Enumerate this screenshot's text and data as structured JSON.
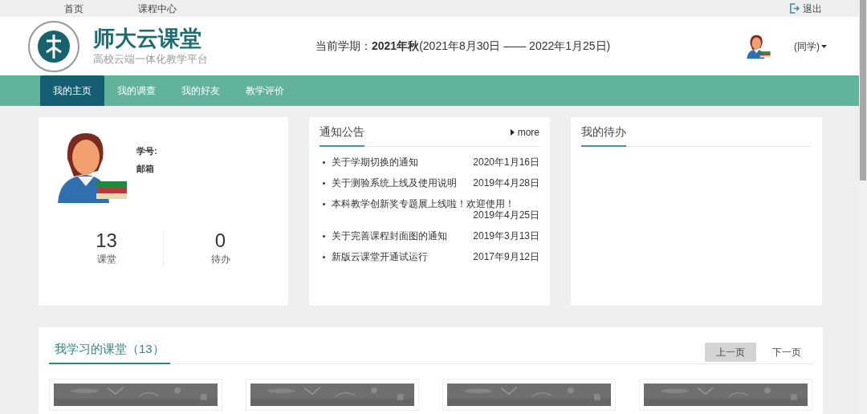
{
  "top_bar": {
    "links": [
      "首页",
      "课程中心"
    ],
    "logout": "退出"
  },
  "header": {
    "site_title": "师大云课堂",
    "site_subtitle": "高校云端一体化教学平台",
    "term_label": "当前学期：",
    "term_name": "2021年秋",
    "term_range": "(2021年8月30日 —— 2022年1月25日)",
    "user_menu": "(同学)"
  },
  "nav": [
    {
      "label": "我的主页",
      "selected": true
    },
    {
      "label": "我的调查",
      "selected": false
    },
    {
      "label": "我的好友",
      "selected": false
    },
    {
      "label": "教学评价",
      "selected": false
    }
  ],
  "profile": {
    "fields": [
      "学号:",
      "邮箱"
    ],
    "stats": [
      {
        "value": "13",
        "label": "课堂"
      },
      {
        "value": "0",
        "label": "待办"
      }
    ]
  },
  "notices": {
    "title": "通知公告",
    "more": "more",
    "items": [
      {
        "title": "关于学期切换的通知",
        "date": "2020年1月16日"
      },
      {
        "title": "关于测验系统上线及使用说明",
        "date": "2019年4月28日"
      },
      {
        "title": "本科教学创新奖专题展上线啦！欢迎使用！",
        "date": "2019年4月25日"
      },
      {
        "title": "关于完善课程封面图的通知",
        "date": "2019年3月13日"
      },
      {
        "title": "新版云课堂开通试运行",
        "date": "2017年9月12日"
      }
    ]
  },
  "todo": {
    "title": "我的待办"
  },
  "courses": {
    "title": "我学习的课堂（13）",
    "pager": [
      {
        "label": "上一页",
        "selected": true
      },
      {
        "label": "下一页",
        "selected": false
      }
    ]
  }
}
